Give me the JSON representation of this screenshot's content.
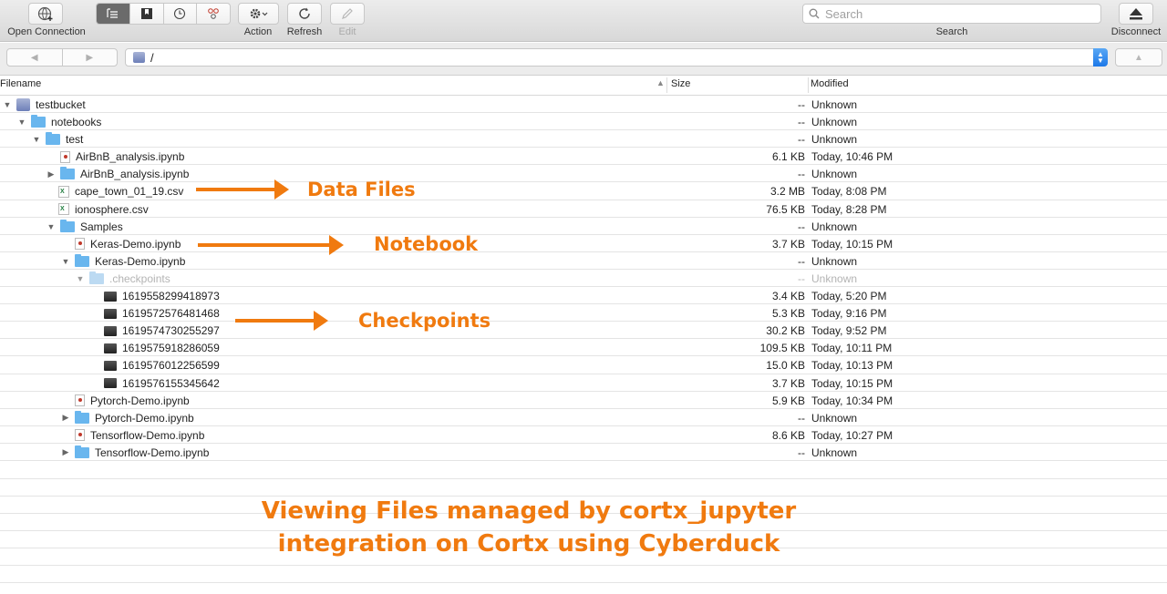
{
  "toolbar": {
    "open_connection": "Open Connection",
    "action": "Action",
    "refresh": "Refresh",
    "edit": "Edit",
    "search_label": "Search",
    "search_placeholder": "Search",
    "disconnect": "Disconnect"
  },
  "pathbar": {
    "path": "/"
  },
  "columns": {
    "filename": "Filename",
    "size": "Size",
    "modified": "Modified"
  },
  "files": [
    {
      "name": "testbucket",
      "size": "--",
      "modified": "Unknown"
    },
    {
      "name": "notebooks",
      "size": "--",
      "modified": "Unknown"
    },
    {
      "name": "test",
      "size": "--",
      "modified": "Unknown"
    },
    {
      "name": "AirBnB_analysis.ipynb",
      "size": "6.1 KB",
      "modified": "Today, 10:46 PM"
    },
    {
      "name": "AirBnB_analysis.ipynb",
      "size": "--",
      "modified": "Unknown"
    },
    {
      "name": "cape_town_01_19.csv",
      "size": "3.2 MB",
      "modified": "Today, 8:08 PM"
    },
    {
      "name": "ionosphere.csv",
      "size": "76.5 KB",
      "modified": "Today, 8:28 PM"
    },
    {
      "name": "Samples",
      "size": "--",
      "modified": "Unknown"
    },
    {
      "name": "Keras-Demo.ipynb",
      "size": "3.7 KB",
      "modified": "Today, 10:15 PM"
    },
    {
      "name": "Keras-Demo.ipynb",
      "size": "--",
      "modified": "Unknown"
    },
    {
      "name": ".checkpoints",
      "size": "--",
      "modified": "Unknown"
    },
    {
      "name": "1619558299418973",
      "size": "3.4 KB",
      "modified": "Today, 5:20 PM"
    },
    {
      "name": "1619572576481468",
      "size": "5.3 KB",
      "modified": "Today, 9:16 PM"
    },
    {
      "name": "1619574730255297",
      "size": "30.2 KB",
      "modified": "Today, 9:52 PM"
    },
    {
      "name": "1619575918286059",
      "size": "109.5 KB",
      "modified": "Today, 10:11 PM"
    },
    {
      "name": "1619576012256599",
      "size": "15.0 KB",
      "modified": "Today, 10:13 PM"
    },
    {
      "name": "1619576155345642",
      "size": "3.7 KB",
      "modified": "Today, 10:15 PM"
    },
    {
      "name": "Pytorch-Demo.ipynb",
      "size": "5.9 KB",
      "modified": "Today, 10:34 PM"
    },
    {
      "name": "Pytorch-Demo.ipynb",
      "size": "--",
      "modified": "Unknown"
    },
    {
      "name": "Tensorflow-Demo.ipynb",
      "size": "8.6 KB",
      "modified": "Today, 10:27 PM"
    },
    {
      "name": "Tensorflow-Demo.ipynb",
      "size": "--",
      "modified": "Unknown"
    }
  ],
  "annotations": {
    "data_files": "Data Files",
    "notebook": "Notebook",
    "checkpoints": "Checkpoints",
    "caption_line1": "Viewing Files managed by cortx_jupyter",
    "caption_line2": "integration on Cortx using Cyberduck"
  },
  "colors": {
    "annotation": "#f07a0f",
    "folder": "#69b6ee",
    "selection": "#1c78e8"
  }
}
